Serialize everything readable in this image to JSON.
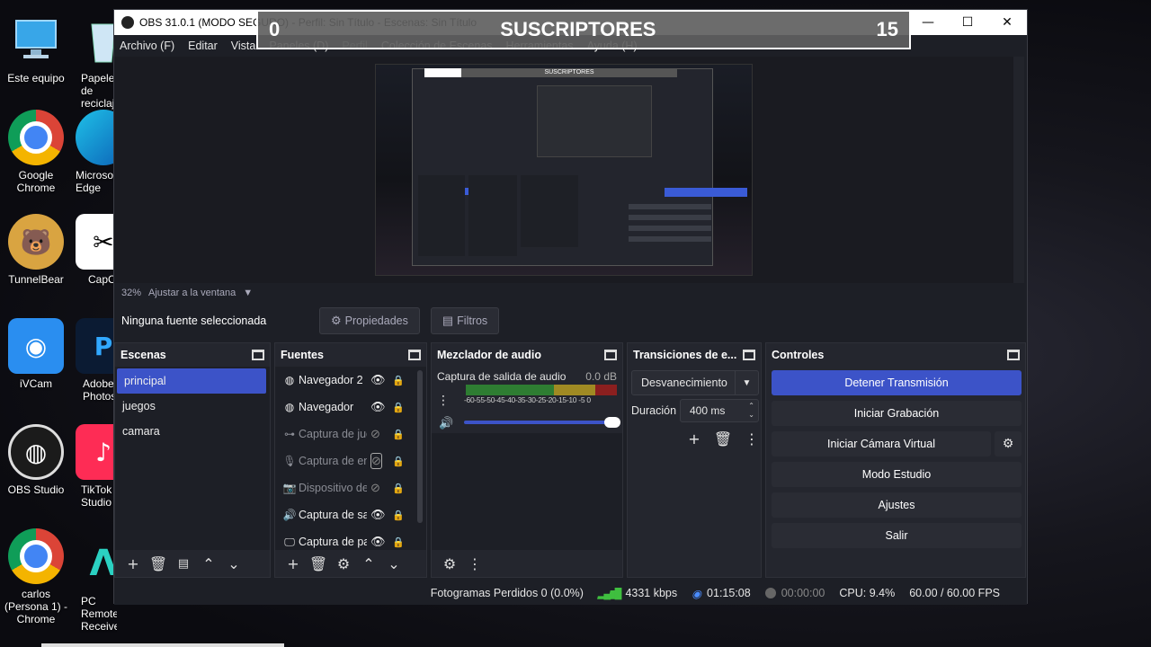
{
  "desktop": {
    "icons": [
      {
        "label": "Este equipo"
      },
      {
        "label": "Papelera de reciclaje"
      },
      {
        "label": "Google Chrome"
      },
      {
        "label": "Microsoft Edge"
      },
      {
        "label": "TunnelBear"
      },
      {
        "label": "CapCut"
      },
      {
        "label": "iVCam"
      },
      {
        "label": "Adobe Photoshop"
      },
      {
        "label": "OBS Studio"
      },
      {
        "label": "TikTok Studio"
      },
      {
        "label": "carlos (Persona 1) - Chrome"
      },
      {
        "label": "PC Remote Receiver"
      }
    ]
  },
  "window": {
    "title": "OBS 31.0.1 (MODO SEGURO) - Perfil: Sin Título - Escenas: Sin Título",
    "menu": [
      "Archivo (F)",
      "Editar",
      "Vista",
      "Paneles (D)",
      "Perfil",
      "Colección de Escenas",
      "Herramientas",
      "Ayuda (H)"
    ]
  },
  "overlay": {
    "left_number": "0",
    "title": "SUSCRIPTORES",
    "right_number": "15"
  },
  "preview": {
    "zoom": "32%",
    "fit_label": "Ajustar a la ventana"
  },
  "source_bar": {
    "no_source": "Ninguna fuente seleccionada",
    "properties": "Propiedades",
    "filters": "Filtros"
  },
  "scenes": {
    "title": "Escenas",
    "items": [
      "principal",
      "juegos",
      "camara"
    ],
    "selected": "principal"
  },
  "sources": {
    "title": "Fuentes",
    "items": [
      {
        "name": "Navegador 2",
        "icon": "globe-icon",
        "visible": true
      },
      {
        "name": "Navegador",
        "icon": "globe-icon",
        "visible": true
      },
      {
        "name": "Captura de juego",
        "icon": "gamepad-icon",
        "visible": false
      },
      {
        "name": "Captura de entrada de audio",
        "icon": "microphone-icon",
        "visible": false
      },
      {
        "name": "Dispositivo de captura de video",
        "icon": "camera-icon",
        "visible": false
      },
      {
        "name": "Captura de salida de audio",
        "icon": "speaker-icon",
        "visible": true
      },
      {
        "name": "Captura de pantalla",
        "icon": "monitor-icon",
        "visible": true
      }
    ]
  },
  "mixer": {
    "title": "Mezclador de audio",
    "channel": "Captura de salida de audio",
    "level": "0.0 dB",
    "ticks": "-60-55-50-45-40-35-30-25-20-15-10 -5  0"
  },
  "transitions": {
    "title": "Transiciones de e...",
    "selected": "Desvanecimiento",
    "duration_label": "Duración",
    "duration": "400 ms"
  },
  "controls": {
    "title": "Controles",
    "buttons": [
      "Detener Transmisión",
      "Iniciar Grabación",
      "Iniciar Cámara Virtual",
      "Modo Estudio",
      "Ajustes",
      "Salir"
    ]
  },
  "status": {
    "dropped": "Fotogramas Perdidos 0 (0.0%)",
    "bitrate": "4331 kbps",
    "stream_time": "01:15:08",
    "rec_time": "00:00:00",
    "cpu": "CPU: 9.4%",
    "fps": "60.00 / 60.00 FPS"
  },
  "colors": {
    "accent": "#3c53c8",
    "background": "#1d1f26",
    "panel": "#24262e"
  }
}
